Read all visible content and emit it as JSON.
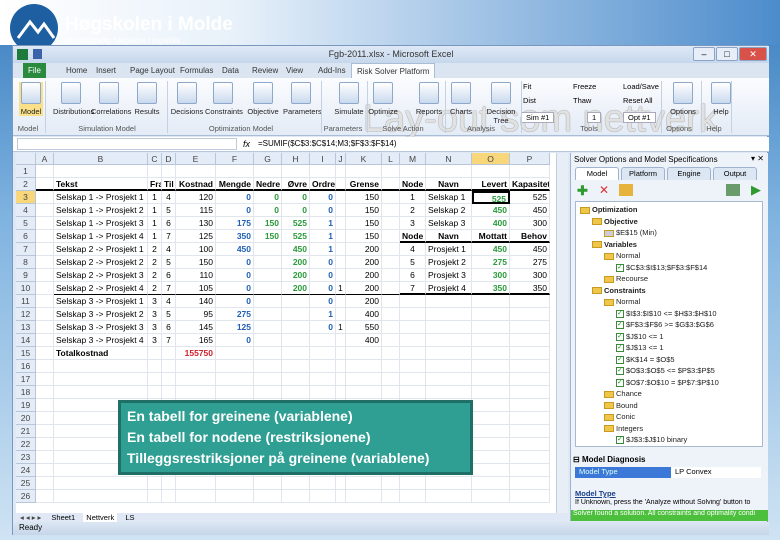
{
  "logo": {
    "name": "Høgskolen i Molde",
    "subtitle": "vitenskapelig høgskole i logistikk"
  },
  "window": {
    "title": "Fgb-2011.xlsx - Microsoft Excel",
    "minimize": "–",
    "maximize": "□",
    "close": "✕"
  },
  "tabs": [
    "File",
    "Home",
    "Insert",
    "Page Layout",
    "Formulas",
    "Data",
    "Review",
    "View",
    "Add-Ins",
    "Risk Solver Platform"
  ],
  "ribbon": {
    "buttons": [
      "Model",
      "Distributions",
      "Correlations",
      "Results",
      "Decisions",
      "Constraints",
      "Objective",
      "Parameters",
      "Simulate",
      "Optimize",
      "Reports",
      "Charts",
      "Decision Tree",
      "Options",
      "Help"
    ],
    "tools": [
      "Fit",
      "Dist",
      "Sim #1",
      "Freeze",
      "Thaw",
      "1",
      "Load/Save",
      "Reset All",
      "Opt #1"
    ],
    "groups": [
      "Model",
      "Simulation Model",
      "Optimization Model",
      "Parameters",
      "Solve Action",
      "Analysis",
      "Tools",
      "Options",
      "Help"
    ]
  },
  "watermark": "Lay-out som nettverk",
  "formula_bar": {
    "fx": "fx",
    "formula": "=SUMIF($C$3:$C$14;M3;$F$3:$F$14)"
  },
  "sheet": {
    "columns": [
      "A",
      "B",
      "C",
      "D",
      "E",
      "F",
      "G",
      "H",
      "I",
      "J",
      "K",
      "L",
      "M",
      "N",
      "O",
      "P"
    ],
    "rows": [
      {
        "n": "1",
        "left": [],
        "right": []
      },
      {
        "n": "2",
        "left": [
          "Tekst",
          "Fra",
          "Til",
          "Kostnad",
          "Mengde",
          "Nedre",
          "Øvre",
          "Ordre",
          "",
          "Grense"
        ],
        "right": [
          "Node",
          "Navn",
          "Levert",
          "Kapasitet"
        ]
      },
      {
        "n": "3",
        "left": [
          "Selskap 1 -> Prosjekt 1",
          "1",
          "4",
          "120",
          "0",
          "0",
          "0",
          "0",
          "",
          "150"
        ],
        "right": [
          "1",
          "Selskap 1",
          "525",
          "525"
        ]
      },
      {
        "n": "4",
        "left": [
          "Selskap 1 -> Prosjekt 2",
          "1",
          "5",
          "115",
          "0",
          "0",
          "0",
          "0",
          "",
          "150"
        ],
        "right": [
          "2",
          "Selskap 2",
          "450",
          "450"
        ]
      },
      {
        "n": "5",
        "left": [
          "Selskap 1 -> Prosjekt 3",
          "1",
          "6",
          "130",
          "175",
          "150",
          "525",
          "1",
          "",
          "150"
        ],
        "right": [
          "3",
          "Selskap 3",
          "400",
          "300"
        ]
      },
      {
        "n": "6",
        "left": [
          "Selskap 1 -> Prosjekt 4",
          "1",
          "7",
          "125",
          "350",
          "150",
          "525",
          "1",
          "",
          "150"
        ],
        "right": [
          "Node",
          "Navn",
          "Mottatt",
          "Behov"
        ]
      },
      {
        "n": "7",
        "left": [
          "Selskap 2 -> Prosjekt 1",
          "2",
          "4",
          "100",
          "450",
          "",
          "450",
          "1",
          "",
          "200"
        ],
        "right": [
          "4",
          "Prosjekt 1",
          "450",
          "450"
        ]
      },
      {
        "n": "8",
        "left": [
          "Selskap 2 -> Prosjekt 2",
          "2",
          "5",
          "150",
          "0",
          "",
          "200",
          "0",
          "",
          "200"
        ],
        "right": [
          "5",
          "Prosjekt 2",
          "275",
          "275"
        ]
      },
      {
        "n": "9",
        "left": [
          "Selskap 2 -> Prosjekt 3",
          "2",
          "6",
          "110",
          "0",
          "",
          "200",
          "0",
          "",
          "200"
        ],
        "right": [
          "6",
          "Prosjekt 3",
          "300",
          "300"
        ]
      },
      {
        "n": "10",
        "left": [
          "Selskap 2 -> Prosjekt 4",
          "2",
          "7",
          "105",
          "0",
          "",
          "200",
          "0",
          "1",
          "200"
        ],
        "right": [
          "7",
          "Prosjekt 4",
          "350",
          "350"
        ]
      },
      {
        "n": "11",
        "left": [
          "Selskap 3 -> Prosjekt 1",
          "3",
          "4",
          "140",
          "0",
          "",
          "",
          "0",
          "",
          "200"
        ],
        "right": []
      },
      {
        "n": "12",
        "left": [
          "Selskap 3 -> Prosjekt 2",
          "3",
          "5",
          "95",
          "275",
          "",
          "",
          "1",
          "",
          "400"
        ],
        "right": []
      },
      {
        "n": "13",
        "left": [
          "Selskap 3 -> Prosjekt 3",
          "3",
          "6",
          "145",
          "125",
          "",
          "",
          "0",
          "1",
          "550"
        ],
        "right": []
      },
      {
        "n": "14",
        "left": [
          "Selskap 3 -> Prosjekt 4",
          "3",
          "7",
          "165",
          "0",
          "",
          "",
          "",
          "",
          "400"
        ],
        "right": []
      },
      {
        "n": "15",
        "left": [
          "Totalkostnad",
          "",
          "",
          "155750"
        ],
        "right": []
      },
      {
        "n": "16",
        "left": [],
        "right": []
      },
      {
        "n": "17",
        "left": [],
        "right": []
      },
      {
        "n": "18",
        "left": [],
        "right": []
      },
      {
        "n": "19",
        "left": [],
        "right": []
      },
      {
        "n": "20",
        "left": [],
        "right": []
      },
      {
        "n": "21",
        "left": [],
        "right": []
      },
      {
        "n": "22",
        "left": [],
        "right": []
      },
      {
        "n": "23",
        "left": [],
        "right": []
      },
      {
        "n": "24",
        "left": [],
        "right": []
      },
      {
        "n": "25",
        "left": [],
        "right": []
      },
      {
        "n": "26",
        "left": [],
        "right": []
      }
    ],
    "colors": {
      "variable": "#1f5fb5",
      "bound": "#2a9a3a",
      "total": "#d0202a"
    }
  },
  "callout": [
    "En tabell for greinene (variablene)",
    "En tabell for nodene (restriksjonene)",
    "Tilleggsrestriksjoner på greinene (variablene)"
  ],
  "sheet_tabs": [
    "Sheet1",
    "Nettverk",
    "LS"
  ],
  "status": "Ready",
  "panel": {
    "title": "Solver Options and Model Specifications",
    "tabs": [
      "Model",
      "Platform",
      "Engine",
      "Output"
    ],
    "tree": [
      {
        "l": 0,
        "t": "Optimization",
        "k": "f"
      },
      {
        "l": 1,
        "t": "Objective",
        "k": "f"
      },
      {
        "l": 2,
        "t": "$E$15 (Min)",
        "k": "i"
      },
      {
        "l": 1,
        "t": "Variables",
        "k": "f"
      },
      {
        "l": 2,
        "t": "Normal",
        "k": "f"
      },
      {
        "l": 3,
        "t": "$C$3:$I$13;$F$3:$F$14",
        "k": "c"
      },
      {
        "l": 2,
        "t": "Recourse",
        "k": "f"
      },
      {
        "l": 1,
        "t": "Constraints",
        "k": "f"
      },
      {
        "l": 2,
        "t": "Normal",
        "k": "f"
      },
      {
        "l": 3,
        "t": "$I$3:$I$10 <= $H$3:$H$10",
        "k": "c"
      },
      {
        "l": 3,
        "t": "$F$3:$F$6 >= $G$3:$G$6",
        "k": "c"
      },
      {
        "l": 3,
        "t": "$J$10 <= 1",
        "k": "c"
      },
      {
        "l": 3,
        "t": "$J$13 <= 1",
        "k": "c"
      },
      {
        "l": 3,
        "t": "$K$14 = $O$5",
        "k": "c"
      },
      {
        "l": 3,
        "t": "$O$3:$O$5 <= $P$3:$P$5",
        "k": "c"
      },
      {
        "l": 3,
        "t": "$O$7:$O$10 = $P$7:$P$10",
        "k": "c"
      },
      {
        "l": 2,
        "t": "Chance",
        "k": "f"
      },
      {
        "l": 2,
        "t": "Bound",
        "k": "f"
      },
      {
        "l": 2,
        "t": "Conic",
        "k": "f"
      },
      {
        "l": 2,
        "t": "Integers",
        "k": "f"
      },
      {
        "l": 3,
        "t": "$J$3:$J$10   binary",
        "k": "c"
      }
    ],
    "diagnosis_title": "Model Diagnosis",
    "diag_key": "Model Type",
    "diag_value": "LP Convex",
    "help_title": "Model Type",
    "help_text": "If Unknown, press the 'Analyze without Solving' button to",
    "result": "Solver found a solution.  All constraints and optimality condi"
  }
}
